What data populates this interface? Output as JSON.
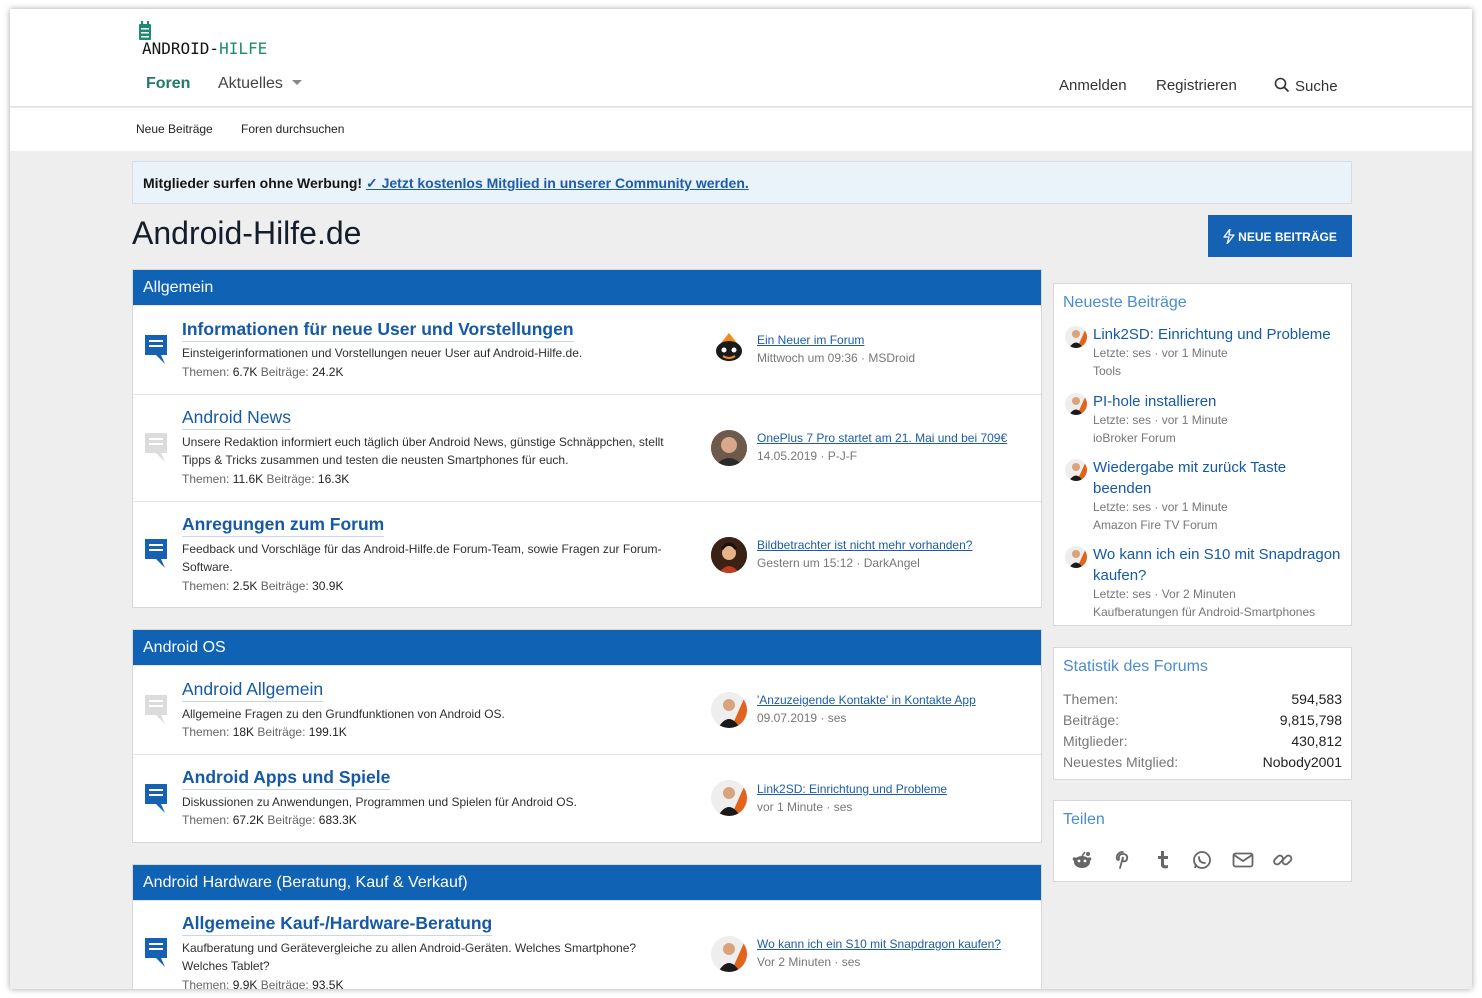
{
  "logo": {
    "part1": "ANDROID-",
    "part2": "HILFE"
  },
  "nav": {
    "tabs": [
      "Foren",
      "Aktuelles"
    ],
    "login": "Anmelden",
    "register": "Registrieren",
    "search": "Suche"
  },
  "subnav": [
    "Neue Beiträge",
    "Foren durchsuchen"
  ],
  "notice": {
    "text": "Mitglieder surfen ohne Werbung!",
    "link": "✓ Jetzt kostenlos Mitglied in unserer Community werden."
  },
  "page_title": "Android-Hilfe.de",
  "new_posts_button": "NEUE BEITRÄGE",
  "stats_labels": {
    "threads": "Themen:",
    "posts": "Beiträge:"
  },
  "categories": [
    {
      "title": "Allgemein",
      "nodes": [
        {
          "title": "Informationen für neue User und Vorstellungen",
          "unread": true,
          "desc": "Einsteigerinformationen und Vorstellungen neuer User auf Android-Hilfe.de.",
          "threads": "6.7K",
          "posts": "24.2K",
          "last_title": "Ein Neuer im Forum",
          "last_meta": "Mittwoch um 09:36 · MSDroid"
        },
        {
          "title": "Android News",
          "unread": false,
          "desc": "Unsere Redaktion informiert euch täglich über Android News, günstige Schnäppchen, stellt Tipps & Tricks zusammen und testen die neusten Smartphones für euch.",
          "threads": "11.6K",
          "posts": "16.3K",
          "last_title": "OnePlus 7 Pro startet am 21. Mai und bei 709€",
          "last_meta": "14.05.2019 · P-J-F"
        },
        {
          "title": "Anregungen zum Forum",
          "unread": true,
          "desc": "Feedback und Vorschläge für das Android-Hilfe.de Forum-Team, sowie Fragen zur Forum-Software.",
          "threads": "2.5K",
          "posts": "30.9K",
          "last_title": "Bildbetrachter ist nicht mehr vorhanden?",
          "last_meta": "Gestern um 15:12 · DarkAngel"
        }
      ]
    },
    {
      "title": "Android OS",
      "nodes": [
        {
          "title": "Android Allgemein",
          "unread": false,
          "desc": "Allgemeine Fragen zu den Grundfunktionen von Android OS.",
          "threads": "18K",
          "posts": "199.1K",
          "last_title": "'Anzuzeigende Kontakte' in Kontakte App",
          "last_meta": "09.07.2019 · ses"
        },
        {
          "title": "Android Apps und Spiele",
          "unread": true,
          "desc": "Diskussionen zu Anwendungen, Programmen und Spielen für Android OS.",
          "threads": "67.2K",
          "posts": "683.3K",
          "last_title": "Link2SD: Einrichtung und Probleme",
          "last_meta": "vor 1 Minute · ses"
        }
      ]
    },
    {
      "title": "Android Hardware (Beratung, Kauf & Verkauf)",
      "nodes": [
        {
          "title": "Allgemeine Kauf-/Hardware-Beratung",
          "unread": true,
          "desc": "Kaufberatung und Gerätevergleiche zu allen Android-Geräten. Welches Smartphone? Welches Tablet?",
          "threads": "9.9K",
          "posts": "93.5K",
          "last_title": "Wo kann ich ein S10 mit Snapdragon kaufen?",
          "last_meta": "Vor 2 Minuten · ses"
        }
      ]
    }
  ],
  "sidebar": {
    "latest": {
      "title": "Neueste Beiträge",
      "items": [
        {
          "title": "Link2SD: Einrichtung und Probleme",
          "meta": "Letzte: ses · vor 1 Minute",
          "forum": "Tools"
        },
        {
          "title": "PI-hole installieren",
          "meta": "Letzte: ses · vor 1 Minute",
          "forum": "ioBroker Forum"
        },
        {
          "title": "Wiedergabe mit zurück Taste beenden",
          "meta": "Letzte: ses · vor 1 Minute",
          "forum": "Amazon Fire TV Forum"
        },
        {
          "title": "Wo kann ich ein S10 mit Snapdragon kaufen?",
          "meta": "Letzte: ses · Vor 2 Minuten",
          "forum": "Kaufberatungen für Android-Smartphones"
        }
      ]
    },
    "stats": {
      "title": "Statistik des Forums",
      "rows": [
        {
          "label": "Themen:",
          "value": "594,583"
        },
        {
          "label": "Beiträge:",
          "value": "9,815,798"
        },
        {
          "label": "Mitglieder:",
          "value": "430,812"
        },
        {
          "label": "Neuestes Mitglied:",
          "value": "Nobody2001"
        }
      ]
    },
    "share": {
      "title": "Teilen",
      "icons": [
        "reddit-icon",
        "pinterest-icon",
        "tumblr-icon",
        "whatsapp-icon",
        "email-icon",
        "link-icon"
      ]
    }
  },
  "colors": {
    "brand": "#0f62b4",
    "accent": "#1f7a6b",
    "link": "#1559a7"
  }
}
